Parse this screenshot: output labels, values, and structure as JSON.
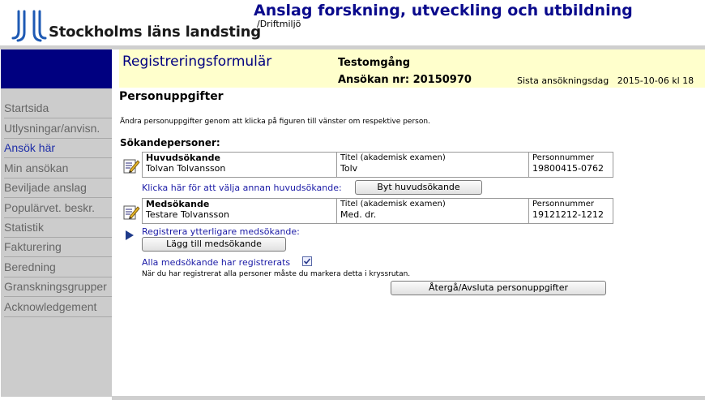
{
  "header": {
    "logo_text": "Stockholms läns landsting",
    "app_title": "Anslag forskning, utveckling och utbildning",
    "environment": "/Driftmiljö"
  },
  "sidebar": {
    "items": [
      {
        "label": "Startsida"
      },
      {
        "label": "Utlysningar/anvisn."
      },
      {
        "label": "Ansök här",
        "active": true
      },
      {
        "label": "Min ansökan"
      },
      {
        "label": "Beviljade anslag"
      },
      {
        "label": "Populärvet. beskr."
      },
      {
        "label": "Statistik"
      },
      {
        "label": "Fakturering"
      },
      {
        "label": "Beredning"
      },
      {
        "label": "Granskningsgrupper"
      },
      {
        "label": "Acknowledgement"
      }
    ]
  },
  "banner": {
    "form_title": "Registreringsformulär",
    "test_label": "Testomgång",
    "application_number": "Ansökan nr: 20150970",
    "deadline": "Sista ansökningsdag   2015-10-06 kl 18"
  },
  "main": {
    "section_title": "Personuppgifter",
    "instructions": "Ändra personuppgifter genom att klicka på figuren till vänster om respektive person.",
    "persons_title": "Sökandepersoner:",
    "main_applicant": {
      "role": "Huvudsökande",
      "name": "Tolvan Tolvansson",
      "title_label": "Titel (akademisk examen)",
      "title_value": "Tolv",
      "pnr_label": "Personnummer",
      "pnr_value": "19800415-0762"
    },
    "change_main_link": "Klicka här för att välja annan huvudsökande:",
    "change_main_button": "Byt huvudsökande",
    "co_applicant": {
      "role": "Medsökande",
      "name": "Testare Tolvansson",
      "title_label": "Titel (akademisk examen)",
      "title_value": "Med. dr.",
      "pnr_label": "Personnummer",
      "pnr_value": "19121212-1212"
    },
    "register_more_link": "Registrera ytterligare medsökande:",
    "add_co_button": "Lägg till medsökande",
    "all_registered_label": "Alla medsökande har registrerats",
    "all_registered_checked": true,
    "note": "När du har registrerat alla personer måste du markera detta i kryssrutan.",
    "finish_button": "Återgå/Avsluta personuppgifter"
  },
  "icons": {
    "logo": "sll-logo-icon",
    "edit": "edit-person-icon",
    "arrow": "play-arrow-icon",
    "checkbox": "checkbox-checked-icon"
  },
  "colors": {
    "title_blue": "#0a0a8c",
    "nav_blue": "#000080",
    "banner_yellow": "#ffffcc",
    "sidebar_grey": "#cccccc",
    "link_blue": "#1a1aa6"
  }
}
